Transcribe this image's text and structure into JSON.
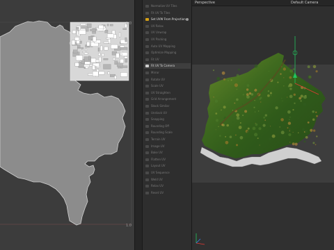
{
  "uv_editor": {
    "tick_top_right": "1.0",
    "tick_bottom_right": "1.0"
  },
  "tool_panel": {
    "items": [
      {
        "label": "Normalize UV Tiles",
        "state": "normal"
      },
      {
        "label": "Fit UV To Tiles",
        "state": "normal"
      },
      {
        "label": "Set UVW From Projection",
        "state": "active"
      },
      {
        "label": "UV Relax",
        "state": "normal"
      },
      {
        "label": "UV Unwrap",
        "state": "normal"
      },
      {
        "label": "UV Packing",
        "state": "normal"
      },
      {
        "label": "Auto UV Mapping",
        "state": "normal"
      },
      {
        "label": "Optimize Mapping",
        "state": "normal"
      },
      {
        "label": "Fit UV",
        "state": "normal"
      },
      {
        "label": "Fit UV To Camera",
        "state": "highlight"
      },
      {
        "label": "Mirror",
        "state": "normal"
      },
      {
        "label": "Rotate UV",
        "state": "normal"
      },
      {
        "label": "Scale UV",
        "state": "normal"
      },
      {
        "label": "UV Straighten",
        "state": "normal"
      },
      {
        "label": "Grid Arrangement",
        "state": "normal"
      },
      {
        "label": "Stack Similar",
        "state": "normal"
      },
      {
        "label": "Unstack UV",
        "state": "normal"
      },
      {
        "label": "Snapping",
        "state": "normal"
      },
      {
        "label": "Rounding Off",
        "state": "normal"
      },
      {
        "label": "Rounding Scale",
        "state": "normal"
      },
      {
        "label": "Terrain UV",
        "state": "normal"
      },
      {
        "label": "Image UV",
        "state": "normal"
      },
      {
        "label": "Bake UV",
        "state": "normal"
      },
      {
        "label": "Flatten UV",
        "state": "normal"
      },
      {
        "label": "Layout UV",
        "state": "normal"
      },
      {
        "label": "UV Sequence",
        "state": "normal"
      },
      {
        "label": "Weld UV",
        "state": "normal"
      },
      {
        "label": "Relax UV",
        "state": "normal"
      },
      {
        "label": "Reset UV",
        "state": "normal"
      }
    ]
  },
  "viewport": {
    "view_name": "Perspective",
    "camera_name": "Default Camera"
  },
  "colors": {
    "uv_shape": "#8c8c8c",
    "uv_background": "#3c3c3c",
    "accent_orange": "#d4a017",
    "axis_green": "#22c55e",
    "axis_red": "#e53935",
    "axis_blue": "#3b82f6"
  }
}
